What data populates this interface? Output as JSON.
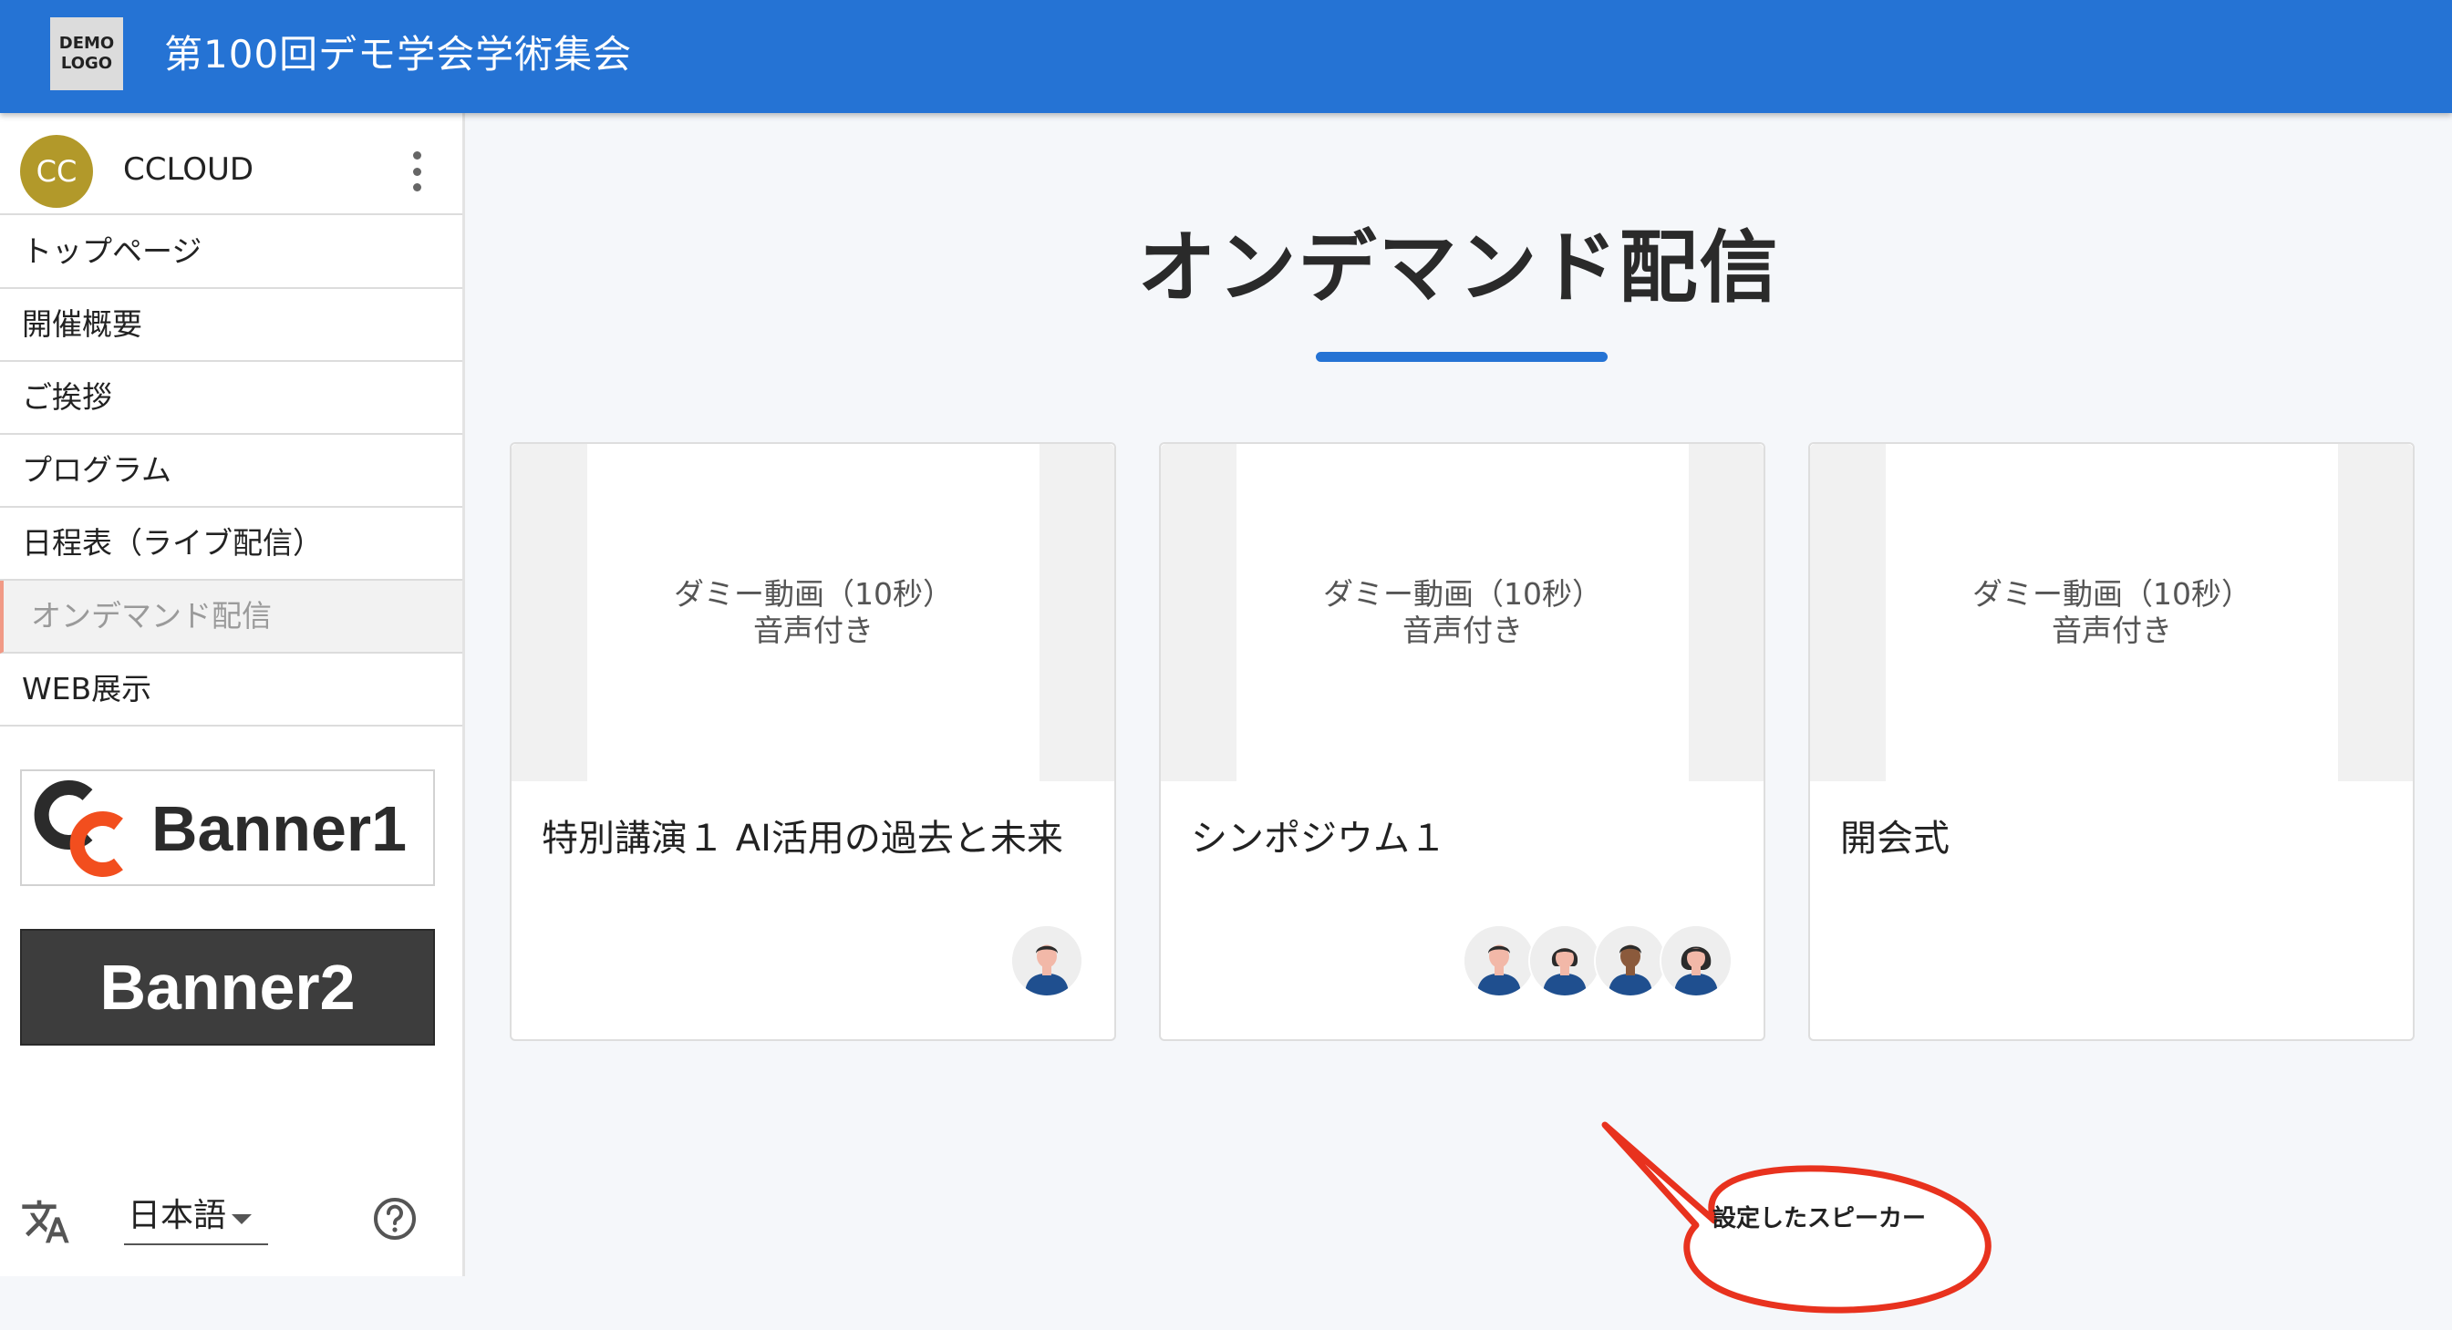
{
  "header": {
    "logo_text": "DEMO\nLOGO",
    "title": "第100回デモ学会学術集会",
    "bg_color": "#2573d4"
  },
  "sidebar": {
    "user": {
      "initials": "CC",
      "name": "CCLOUD",
      "avatar_color": "#b2992a",
      "menu_icon": "more-vert-icon"
    },
    "items": [
      {
        "label": "トップページ",
        "active": false
      },
      {
        "label": "開催概要",
        "active": false
      },
      {
        "label": "ご挨拶",
        "active": false
      },
      {
        "label": "プログラム",
        "active": false
      },
      {
        "label": "日程表（ライブ配信）",
        "active": false
      },
      {
        "label": "オンデマンド配信",
        "active": true
      },
      {
        "label": "WEB展示",
        "active": false
      }
    ],
    "banners": [
      {
        "label": "Banner1",
        "logo": "CC"
      },
      {
        "label": "Banner2"
      }
    ],
    "footer": {
      "translate_icon": "translate-icon",
      "language": "日本語",
      "help_icon": "help-circle-icon"
    }
  },
  "main": {
    "title": "オンデマンド配信",
    "accent_color": "#2573d4",
    "cards": [
      {
        "thumb_line1": "ダミー動画（10秒）",
        "thumb_line2": "音声付き",
        "title": "特別講演１ AI活用の過去と未来",
        "speaker_count": 1
      },
      {
        "thumb_line1": "ダミー動画（10秒）",
        "thumb_line2": "音声付き",
        "title": "シンポジウム１",
        "speaker_count": 4
      },
      {
        "thumb_line1": "ダミー動画（10秒）",
        "thumb_line2": "音声付き",
        "title": "開会式",
        "speaker_count": 0
      }
    ],
    "callout": {
      "text": "設定したスピーカー",
      "color": "#e8321e"
    }
  }
}
